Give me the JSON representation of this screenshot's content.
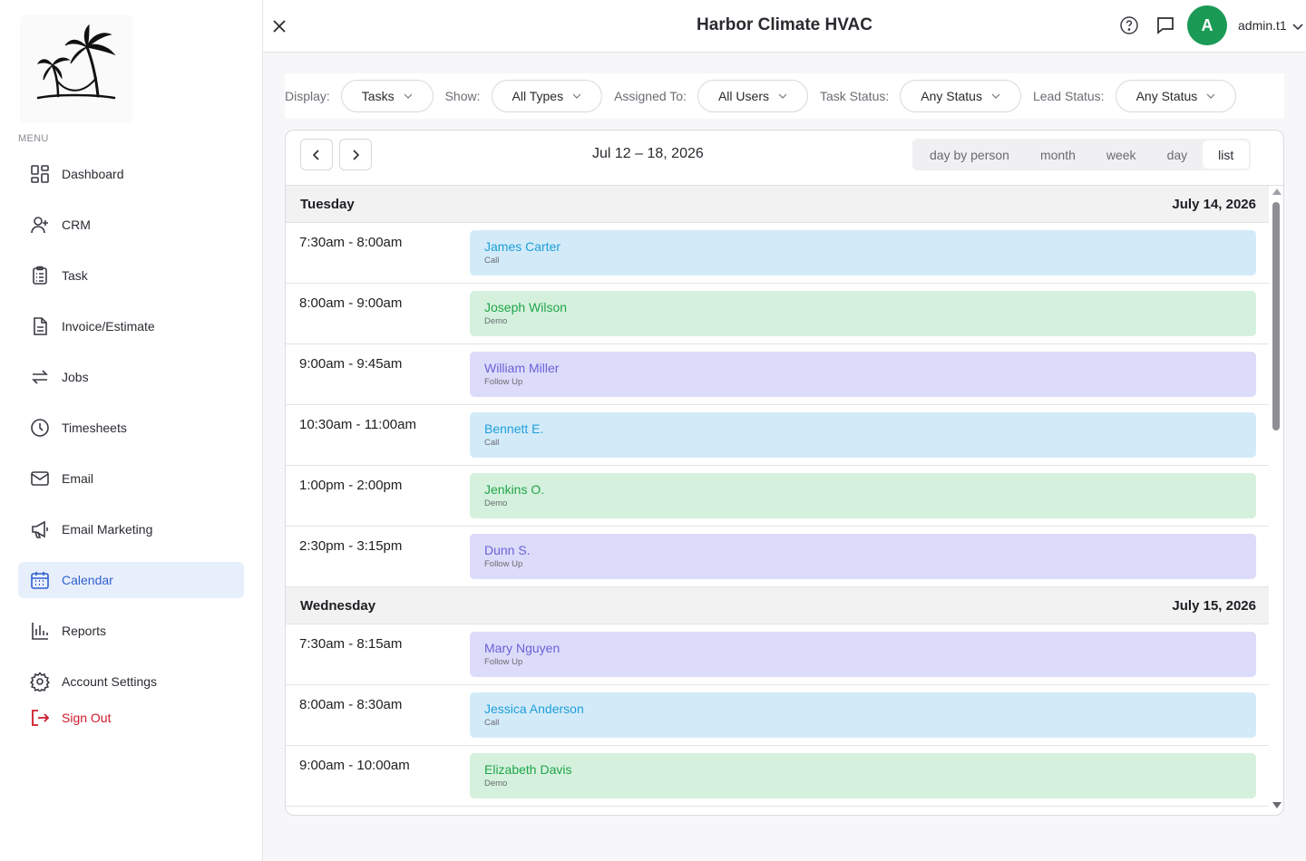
{
  "sidebar": {
    "menu_label": "MENU",
    "items": [
      {
        "label": "Dashboard",
        "icon": "dashboard-icon"
      },
      {
        "label": "CRM",
        "icon": "user-plus-icon"
      },
      {
        "label": "Task",
        "icon": "clipboard-icon"
      },
      {
        "label": "Invoice/Estimate",
        "icon": "document-icon"
      },
      {
        "label": "Jobs",
        "icon": "repeat-icon"
      },
      {
        "label": "Timesheets",
        "icon": "clock-icon"
      },
      {
        "label": "Email",
        "icon": "mail-icon"
      },
      {
        "label": "Email Marketing",
        "icon": "megaphone-icon"
      },
      {
        "label": "Calendar",
        "icon": "calendar-icon",
        "active": true
      },
      {
        "label": "Reports",
        "icon": "bar-chart-icon"
      },
      {
        "label": "Account Settings",
        "icon": "gear-icon"
      }
    ],
    "signout_label": "Sign Out"
  },
  "header": {
    "title": "Harbor Climate HVAC",
    "avatar_letter": "A",
    "username": "admin.t1",
    "avatar_color": "#1a9a55"
  },
  "filters": {
    "display_label": "Display:",
    "display_value": "Tasks",
    "show_label": "Show:",
    "show_value": "All Types",
    "assigned_label": "Assigned To:",
    "assigned_value": "All Users",
    "task_status_label": "Task Status:",
    "task_status_value": "Any Status",
    "lead_status_label": "Lead Status:",
    "lead_status_value": "Any Status"
  },
  "calendar": {
    "range": "Jul 12 – 18, 2026",
    "views": [
      "day by person",
      "month",
      "week",
      "day",
      "list"
    ],
    "active_view": "list",
    "days": [
      {
        "name": "Tuesday",
        "date": "July 14, 2026",
        "events": [
          {
            "time": "7:30am - 8:00am",
            "name": "James Carter",
            "type": "Call"
          },
          {
            "time": "8:00am - 9:00am",
            "name": "Joseph Wilson",
            "type": "Demo"
          },
          {
            "time": "9:00am - 9:45am",
            "name": "William Miller",
            "type": "Follow Up"
          },
          {
            "time": "10:30am - 11:00am",
            "name": "Bennett E.",
            "type": "Call"
          },
          {
            "time": "1:00pm - 2:00pm",
            "name": "Jenkins O.",
            "type": "Demo"
          },
          {
            "time": "2:30pm - 3:15pm",
            "name": "Dunn S.",
            "type": "Follow Up"
          }
        ]
      },
      {
        "name": "Wednesday",
        "date": "July 15, 2026",
        "events": [
          {
            "time": "7:30am - 8:15am",
            "name": "Mary Nguyen",
            "type": "Follow Up"
          },
          {
            "time": "8:00am - 8:30am",
            "name": "Jessica Anderson",
            "type": "Call"
          },
          {
            "time": "9:00am - 10:00am",
            "name": "Elizabeth Davis",
            "type": "Demo"
          }
        ]
      }
    ]
  },
  "colors": {
    "call_bg": "#d3ebf9",
    "demo_bg": "#d5f1dd",
    "follow_up_bg": "#dcdcfa",
    "accent": "#2f5fd0",
    "signout": "#d01a2a"
  }
}
